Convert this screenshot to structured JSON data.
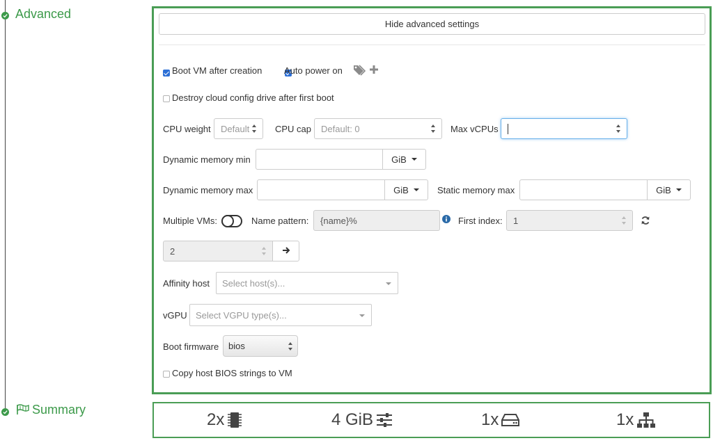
{
  "steps": {
    "advanced": {
      "title": "Advanced"
    },
    "summary": {
      "title": "Summary"
    }
  },
  "advanced": {
    "hide_button": "Hide advanced settings",
    "boot_vm": {
      "label": "Boot VM after creation",
      "checked": true
    },
    "auto_power": {
      "label": "Auto power on",
      "checked": true
    },
    "destroy_cloud": {
      "label": "Destroy cloud config drive after first boot",
      "checked": false
    },
    "cpu_weight": {
      "label": "CPU weight",
      "placeholder": "Default"
    },
    "cpu_cap": {
      "label": "CPU cap",
      "placeholder": "Default: 0"
    },
    "max_vcpus": {
      "label": "Max vCPUs",
      "value": ""
    },
    "dyn_mem_min": {
      "label": "Dynamic memory min",
      "unit": "GiB"
    },
    "dyn_mem_max": {
      "label": "Dynamic memory max",
      "unit": "GiB"
    },
    "static_mem_max": {
      "label": "Static memory max",
      "unit": "GiB"
    },
    "multiple_vms": {
      "label": "Multiple VMs:",
      "enabled": false
    },
    "name_pattern": {
      "label": "Name pattern:",
      "value": "{name}%"
    },
    "first_index": {
      "label": "First index:",
      "value": "1"
    },
    "vm_count": {
      "value": "2"
    },
    "affinity_host": {
      "label": "Affinity host",
      "placeholder": "Select host(s)..."
    },
    "vgpu": {
      "label": "vGPU",
      "placeholder": "Select VGPU type(s)..."
    },
    "boot_firmware": {
      "label": "Boot firmware",
      "value": "bios"
    },
    "copy_bios": {
      "label": "Copy host BIOS strings to VM",
      "checked": false
    }
  },
  "summary": {
    "cpus": "2x",
    "memory": "4 GiB",
    "disks": "1x",
    "networks": "1x"
  },
  "colors": {
    "accent": "#4a9d55",
    "checkbox": "#2c6fd6"
  }
}
